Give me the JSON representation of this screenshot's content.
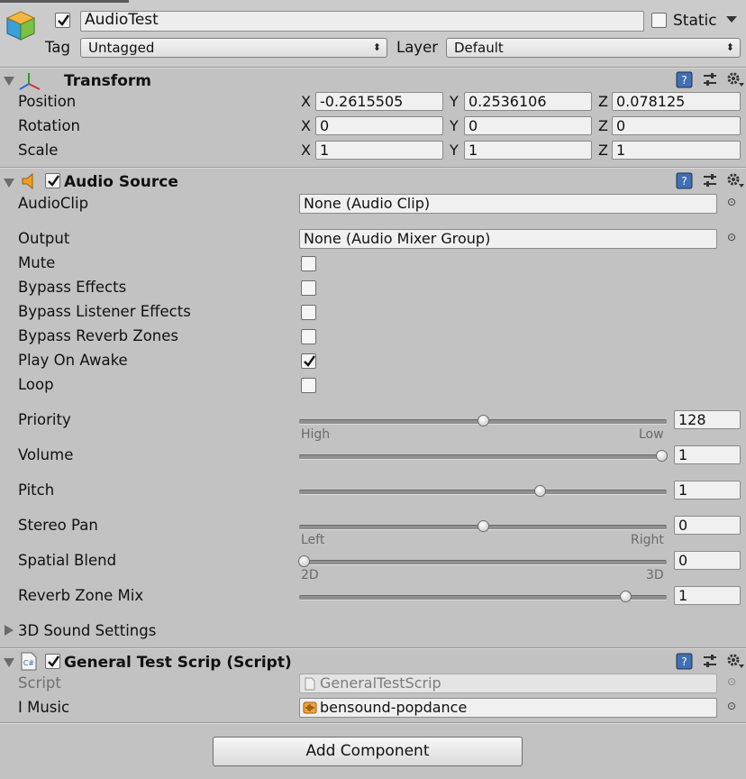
{
  "header": {
    "object_name": "AudioTest",
    "static_label": "Static",
    "tag_label": "Tag",
    "tag_value": "Untagged",
    "layer_label": "Layer",
    "layer_value": "Default"
  },
  "transform": {
    "title": "Transform",
    "rows": [
      {
        "label": "Position",
        "x": "-0.2615505",
        "y": "0.2536106",
        "z": "0.078125"
      },
      {
        "label": "Rotation",
        "x": "0",
        "y": "0",
        "z": "0"
      },
      {
        "label": "Scale",
        "x": "1",
        "y": "1",
        "z": "1"
      }
    ],
    "axis_x": "X",
    "axis_y": "Y",
    "axis_z": "Z"
  },
  "audio_source": {
    "title": "Audio Source",
    "audioclip_label": "AudioClip",
    "audioclip_value": "None (Audio Clip)",
    "output_label": "Output",
    "output_value": "None (Audio Mixer Group)",
    "toggles": [
      {
        "label": "Mute",
        "checked": false
      },
      {
        "label": "Bypass Effects",
        "checked": false
      },
      {
        "label": "Bypass Listener Effects",
        "checked": false
      },
      {
        "label": "Bypass Reverb Zones",
        "checked": false
      },
      {
        "label": "Play On Awake",
        "checked": true
      },
      {
        "label": "Loop",
        "checked": false
      }
    ],
    "sliders": [
      {
        "label": "Priority",
        "value": "128",
        "fraction": 0.5,
        "min_label": "High",
        "max_label": "Low"
      },
      {
        "label": "Volume",
        "value": "1",
        "fraction": 1.0
      },
      {
        "label": "Pitch",
        "value": "1",
        "fraction": 0.66
      },
      {
        "label": "Stereo Pan",
        "value": "0",
        "fraction": 0.5,
        "min_label": "Left",
        "max_label": "Right"
      },
      {
        "label": "Spatial Blend",
        "value": "0",
        "fraction": 0.0,
        "min_label": "2D",
        "max_label": "3D"
      },
      {
        "label": "Reverb Zone Mix",
        "value": "1",
        "fraction": 0.9
      }
    ],
    "sound3d_label": "3D Sound Settings"
  },
  "script_component": {
    "title": "General Test Scrip (Script)",
    "script_label": "Script",
    "script_value": "GeneralTestScrip",
    "music_label": "I Music",
    "music_value": "bensound-popdance"
  },
  "add_component_label": "Add Component"
}
